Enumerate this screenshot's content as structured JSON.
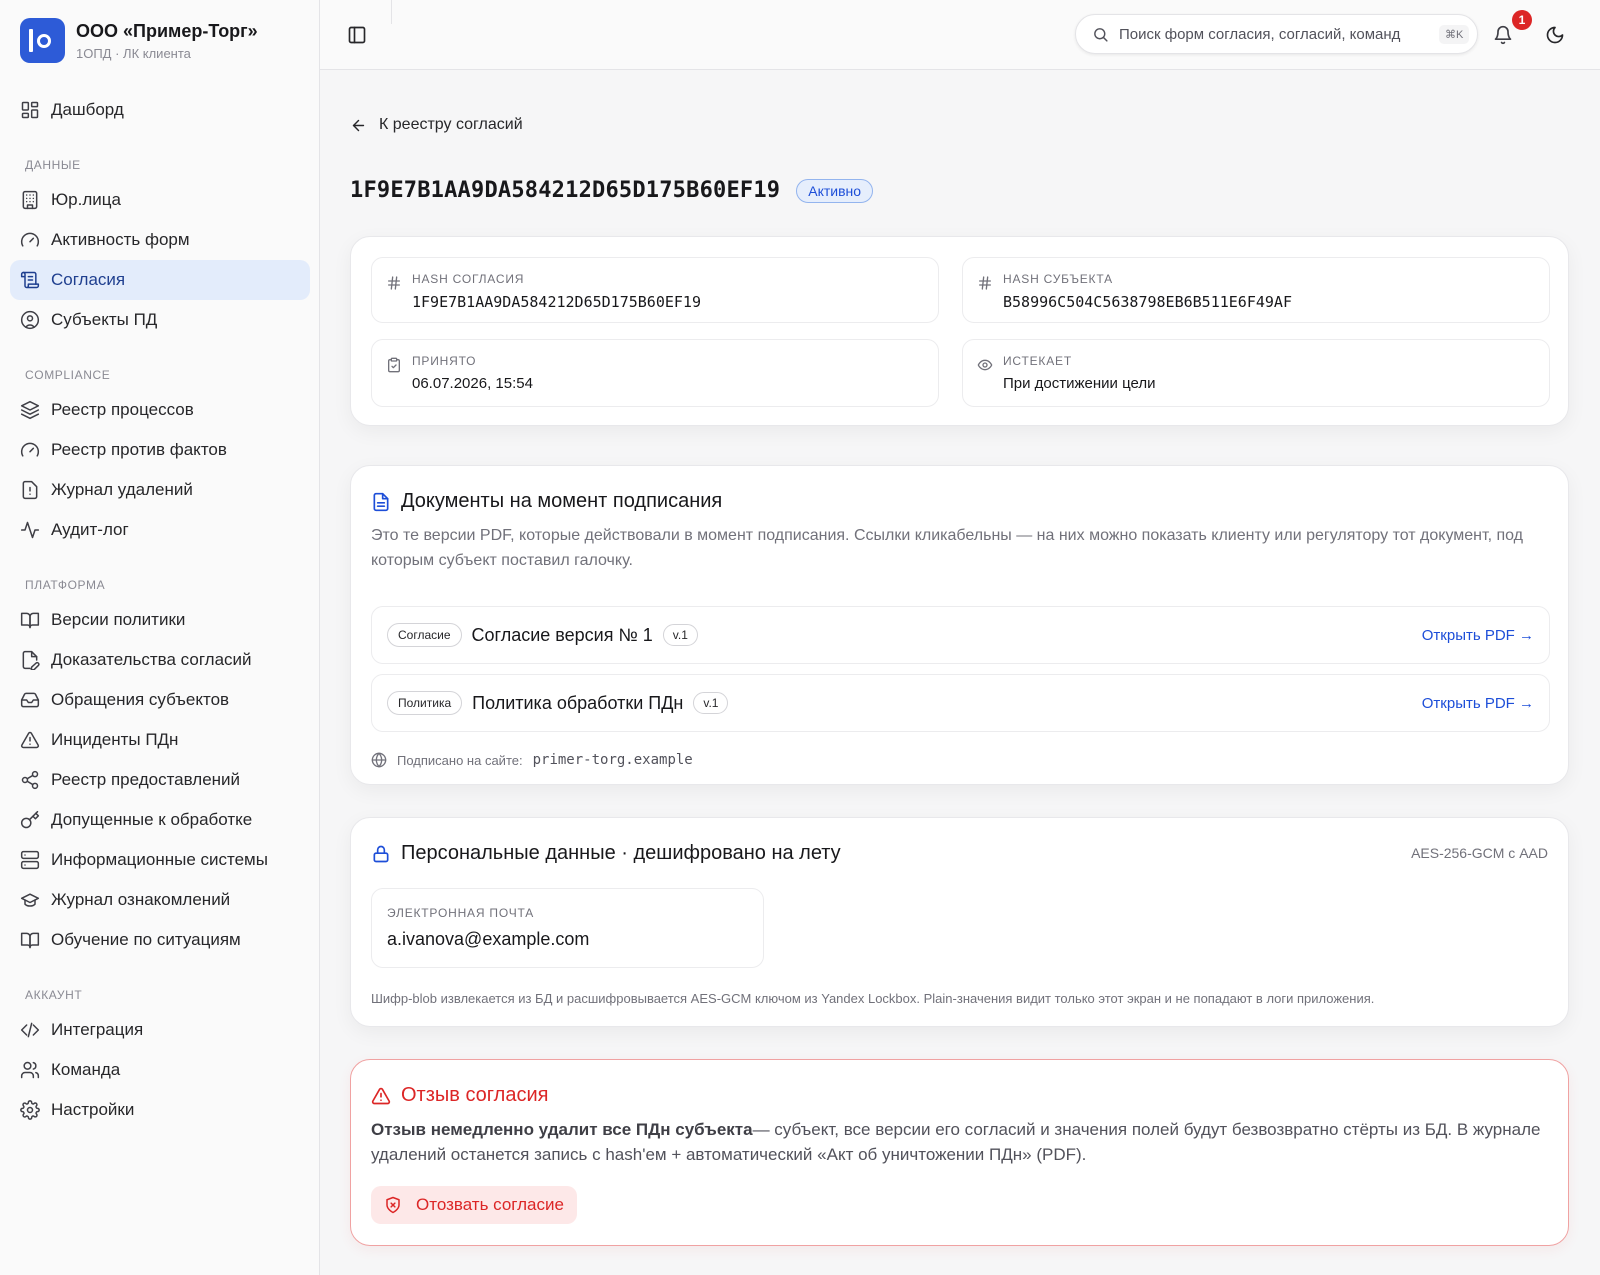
{
  "brand": {
    "name": "ООО «Пример-Торг»",
    "subtitle": "1ОПД · ЛК клиента"
  },
  "sidebar": {
    "top_item": {
      "label": "Дашборд",
      "icon": "dashboard-icon"
    },
    "sections": [
      {
        "title": "ДАННЫЕ",
        "items": [
          {
            "label": "Юр.лица",
            "icon": "building-icon"
          },
          {
            "label": "Активность форм",
            "icon": "gauge-icon"
          },
          {
            "label": "Согласия",
            "icon": "scroll-icon",
            "active": true
          },
          {
            "label": "Субъекты ПД",
            "icon": "user-circle-icon"
          }
        ]
      },
      {
        "title": "COMPLIANCE",
        "items": [
          {
            "label": "Реестр процессов",
            "icon": "layers-icon"
          },
          {
            "label": "Реестр против фактов",
            "icon": "gauge-icon"
          },
          {
            "label": "Журнал удалений",
            "icon": "file-alert-icon"
          },
          {
            "label": "Аудит-лог",
            "icon": "activity-icon"
          }
        ]
      },
      {
        "title": "ПЛАТФОРМА",
        "items": [
          {
            "label": "Версии политики",
            "icon": "book-icon"
          },
          {
            "label": "Доказательства согласий",
            "icon": "file-pen-icon"
          },
          {
            "label": "Обращения субъектов",
            "icon": "inbox-icon"
          },
          {
            "label": "Инциденты ПДн",
            "icon": "alert-triangle-icon"
          },
          {
            "label": "Реестр предоставлений",
            "icon": "share-icon"
          },
          {
            "label": "Допущенные к обработке",
            "icon": "key-icon"
          },
          {
            "label": "Информационные системы",
            "icon": "server-icon"
          },
          {
            "label": "Журнал ознакомлений",
            "icon": "graduation-cap-icon"
          },
          {
            "label": "Обучение по ситуациям",
            "icon": "book-icon"
          }
        ]
      },
      {
        "title": "АККАУНТ",
        "items": [
          {
            "label": "Интеграция",
            "icon": "code-icon"
          },
          {
            "label": "Команда",
            "icon": "users-icon"
          },
          {
            "label": "Настройки",
            "icon": "gear-icon"
          }
        ]
      }
    ]
  },
  "topbar": {
    "search_placeholder": "Поиск форм согласия, согласий, команд",
    "shortcut": "⌘K",
    "notifications_count": "1"
  },
  "page": {
    "back_label": "К реестру согласий",
    "title": "1F9E7B1AA9DA584212D65D175B60EF19",
    "status": "Активно"
  },
  "info": {
    "consent_hash_label": "HASH СОГЛАСИЯ",
    "consent_hash": "1F9E7B1AA9DA584212D65D175B60EF19",
    "subject_hash_label": "HASH СУБЪЕКТА",
    "subject_hash": "B58996C504C5638798EB6B511E6F49AF",
    "accepted_label": "ПРИНЯТО",
    "accepted": "06.07.2026, 15:54",
    "expires_label": "ИСТЕКАЕТ",
    "expires": "При достижении цели"
  },
  "documents": {
    "title": "Документы на момент подписания",
    "description": "Это те версии PDF, которые действовали в момент подписания. Ссылки кликабельны — на них можно показать клиенту или регулятору тот документ, под которым субъект поставил галочку.",
    "items": [
      {
        "tag": "Согласие",
        "name": "Согласие версия № 1",
        "version": "v.1",
        "link": "Открыть PDF →"
      },
      {
        "tag": "Политика",
        "name": "Политика обработки ПДн",
        "version": "v.1",
        "link": "Открыть PDF →"
      }
    ],
    "signed_label": "Подписано на сайте:",
    "signed_site": "primer-torg.example"
  },
  "personal": {
    "title": "Персональные данные · дешифровано на лету",
    "algorithm": "AES-256-GCM с AAD",
    "email_label": "ЭЛЕКТРОННАЯ ПОЧТА",
    "email": "a.ivanova@example.com",
    "note": "Шифр-blob извлекается из БД и расшифровывается AES-GCM ключом из Yandex Lockbox. Plain-значения видит только этот экран и не попадают в логи приложения."
  },
  "revoke": {
    "title": "Отзыв согласия",
    "text_bold": "Отзыв немедленно удалит все ПДн субъекта",
    "text_rest": "— субъект, все версии его согласий и значения полей будут безвозвратно стёрты из БД. В журнале удалений останется запись с hash'ем + автоматический «Акт об уничтожении ПДн» (PDF).",
    "button_label": "Отозвать согласие"
  },
  "colors": {
    "accent": "#1d4ed8",
    "danger": "#dc2626",
    "brand": "#2d5bd7",
    "active_bg": "#e3ecfb"
  }
}
